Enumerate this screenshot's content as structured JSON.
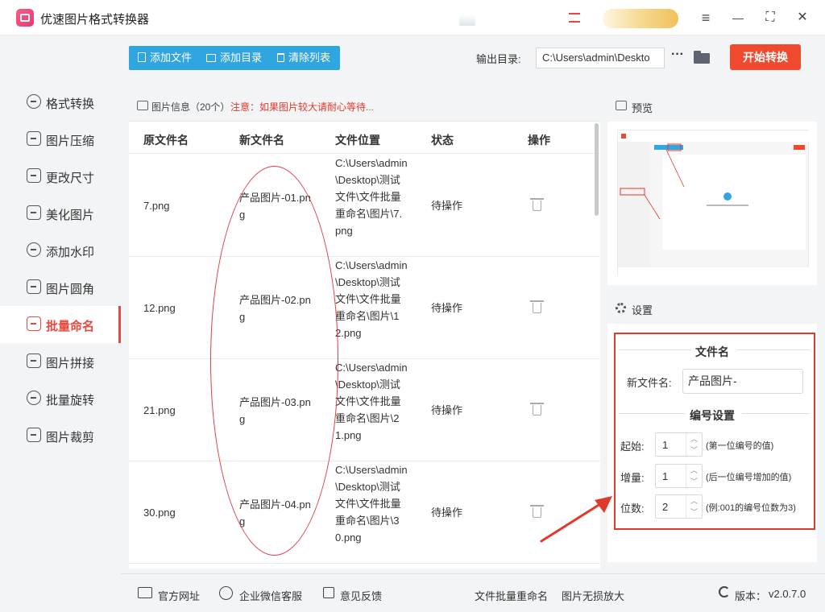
{
  "app": {
    "title": "优速图片格式转换器"
  },
  "window_controls": {
    "menu": "≡",
    "minimize": "—",
    "fullscreen": "⛶",
    "close": "✕"
  },
  "sidebar": {
    "items": [
      {
        "label": "格式转换",
        "icon": "format-convert-icon",
        "active": false
      },
      {
        "label": "图片压缩",
        "icon": "compress-icon",
        "active": false
      },
      {
        "label": "更改尺寸",
        "icon": "resize-icon",
        "active": false
      },
      {
        "label": "美化图片",
        "icon": "beautify-icon",
        "active": false
      },
      {
        "label": "添加水印",
        "icon": "watermark-icon",
        "active": false
      },
      {
        "label": "图片圆角",
        "icon": "round-corner-icon",
        "active": false
      },
      {
        "label": "批量命名",
        "icon": "batch-rename-icon",
        "active": true
      },
      {
        "label": "图片拼接",
        "icon": "stitch-icon",
        "active": false
      },
      {
        "label": "批量旋转",
        "icon": "rotate-icon",
        "active": false
      },
      {
        "label": "图片裁剪",
        "icon": "crop-icon",
        "active": false
      }
    ]
  },
  "toolbar": {
    "add_file": "添加文件",
    "add_dir": "添加目录",
    "clear_list": "清除列表",
    "output_label": "输出目录:",
    "output_path": "C:\\Users\\admin\\Deskto",
    "more": "···",
    "start": "开始转换"
  },
  "info": {
    "text": "图片信息（20个）",
    "warning": "注意：如果图片较大请耐心等待..."
  },
  "table": {
    "headers": [
      "原文件名",
      "新文件名",
      "文件位置",
      "状态",
      "操作"
    ],
    "rows": [
      {
        "orig": "7.png",
        "new": "产品图片-01.png",
        "location": "C:\\Users\\admin\\Desktop\\测试文件\\文件批量重命名\\图片\\7.png",
        "status": "待操作"
      },
      {
        "orig": "12.png",
        "new": "产品图片-02.png",
        "location": "C:\\Users\\admin\\Desktop\\测试文件\\文件批量重命名\\图片\\12.png",
        "status": "待操作"
      },
      {
        "orig": "21.png",
        "new": "产品图片-03.png",
        "location": "C:\\Users\\admin\\Desktop\\测试文件\\文件批量重命名\\图片\\21.png",
        "status": "待操作"
      },
      {
        "orig": "30.png",
        "new": "产品图片-04.png",
        "location": "C:\\Users\\admin\\Desktop\\测试文件\\文件批量重命名\\图片\\30.png",
        "status": "待操作"
      }
    ]
  },
  "preview": {
    "title": "预览"
  },
  "settings": {
    "title": "设置",
    "filename_section": "文件名",
    "new_name_label": "新文件名:",
    "new_name_value": "产品图片-",
    "numbering_section": "编号设置",
    "start_label": "起始:",
    "start_value": "1",
    "start_hint": "(第一位编号的值)",
    "step_label": "增量:",
    "step_value": "1",
    "step_hint": "(后一位编号增加的值)",
    "digits_label": "位数:",
    "digits_value": "2",
    "digits_hint": "(例:001的编号位数为3)"
  },
  "footer": {
    "website": "官方网址",
    "wechat": "企业微信客服",
    "feedback": "意见反馈",
    "link1": "文件批量重命名",
    "link2": "图片无损放大",
    "version_label": "版本：",
    "version": "v2.0.7.0"
  },
  "colors": {
    "accent": "#e8483d",
    "toolbar": "#30a6e0",
    "start": "#f04a2e",
    "annotation": "#e23a2a"
  }
}
